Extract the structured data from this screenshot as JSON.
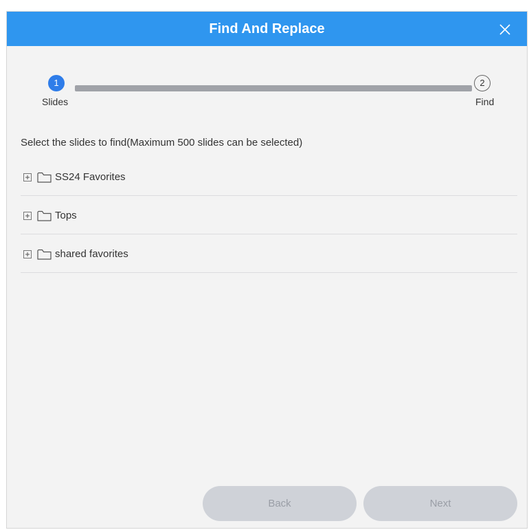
{
  "dialog": {
    "title": "Find And Replace",
    "close_icon": "close-icon"
  },
  "stepper": {
    "steps": [
      {
        "number": "1",
        "label": "Slides",
        "state": "active"
      },
      {
        "number": "2",
        "label": "Find",
        "state": "pending"
      }
    ],
    "active_color": "#2f7de9",
    "track_color": "#a0a2a8"
  },
  "instruction": "Select the slides to find(Maximum 500 slides can be selected)",
  "tree": {
    "items": [
      {
        "label": "SS24 Favorites",
        "expand_icon": "plus-square-icon",
        "type_icon": "folder-icon"
      },
      {
        "label": "Tops",
        "expand_icon": "plus-square-icon",
        "type_icon": "folder-icon"
      },
      {
        "label": "shared favorites",
        "expand_icon": "plus-square-icon",
        "type_icon": "folder-icon"
      }
    ]
  },
  "buttons": {
    "back_label": "Back",
    "next_label": "Next"
  },
  "colors": {
    "header": "#2f96ef",
    "background": "#f3f3f3",
    "button_disabled": "#cfd2d8"
  }
}
